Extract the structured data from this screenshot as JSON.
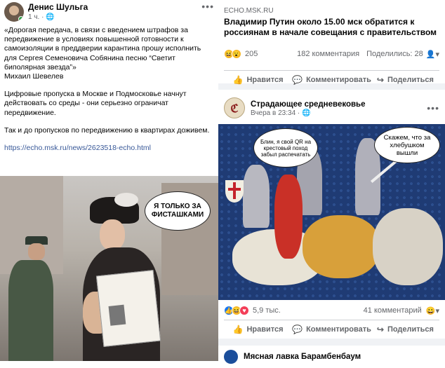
{
  "left_post": {
    "author": "Денис Шульга",
    "time": "1 ч.",
    "privacy_icon": "globe-icon",
    "menu_label": "•••",
    "paragraph1": "«Дорогая передача, в связи с введением штрафов за передвижение в условиях повышенной готовности к самоизоляции в преддверии карантина прошу исполнить для Сергея Семеновича Собянина песню “Светит биполярная звезда”»",
    "signature": "Михаил Шевелев",
    "paragraph2": "Цифровые пропуска в Москве и Подмосковье начнут действовать со среды - они серьезно ограничат передвижение.",
    "paragraph3": "Так и до пропусков по передвижению в квартирах доживем.",
    "link": "https://echo.msk.ru/news/2623518-echo.html",
    "meme_text": "Я ТОЛЬКО ЗА ФИСТАШКАМИ"
  },
  "card1": {
    "domain": "ECHO.MSK.RU",
    "headline": "Владимир Путин около 15.00 мск обратится к россиянам в начале совещания с правительством",
    "reactions_count": "205",
    "comments": "182 комментария",
    "shares": "Поделились: 28",
    "like_label": "Нравится",
    "comment_label": "Комментировать",
    "share_label": "Поделиться"
  },
  "card2": {
    "page_name": "Страдающее средневековье",
    "time": "Вчера в 23:34",
    "bubble_left": "Блин, я свой QR на крестовый поход забыл распечатать",
    "bubble_right": "Скажем, что за хлебушком вышли",
    "reactions_count": "5,9 тыс.",
    "comments": "41 комментарий",
    "like_label": "Нравится",
    "comment_label": "Комментировать",
    "share_label": "Поделиться"
  },
  "card3": {
    "page_name": "Мясная лавка Барамбенбаум"
  }
}
